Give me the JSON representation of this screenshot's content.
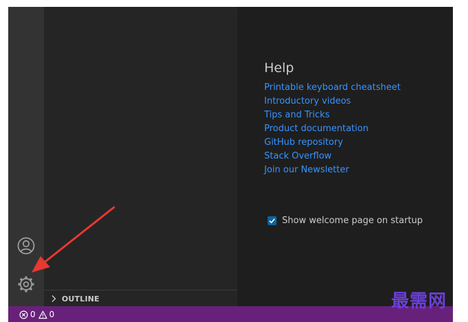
{
  "activity_bar": {
    "icons": [
      "account-icon",
      "gear-icon"
    ]
  },
  "sidebar": {
    "outline": {
      "label": "OUTLINE",
      "icon": "chevron-right-icon"
    }
  },
  "welcome": {
    "help": {
      "title": "Help",
      "links": [
        "Printable keyboard cheatsheet",
        "Introductory videos",
        "Tips and Tricks",
        "Product documentation",
        "GitHub repository",
        "Stack Overflow",
        "Join our Newsletter"
      ]
    },
    "startup": {
      "label": "Show welcome page on startup",
      "checked": true
    }
  },
  "status_bar": {
    "errors": "0",
    "warnings": "0"
  },
  "watermark": "最需网",
  "colors": {
    "link": "#3794ff",
    "status_bar": "#68217a",
    "arrow": "#e8382f",
    "watermark": "#6b3fd6"
  }
}
